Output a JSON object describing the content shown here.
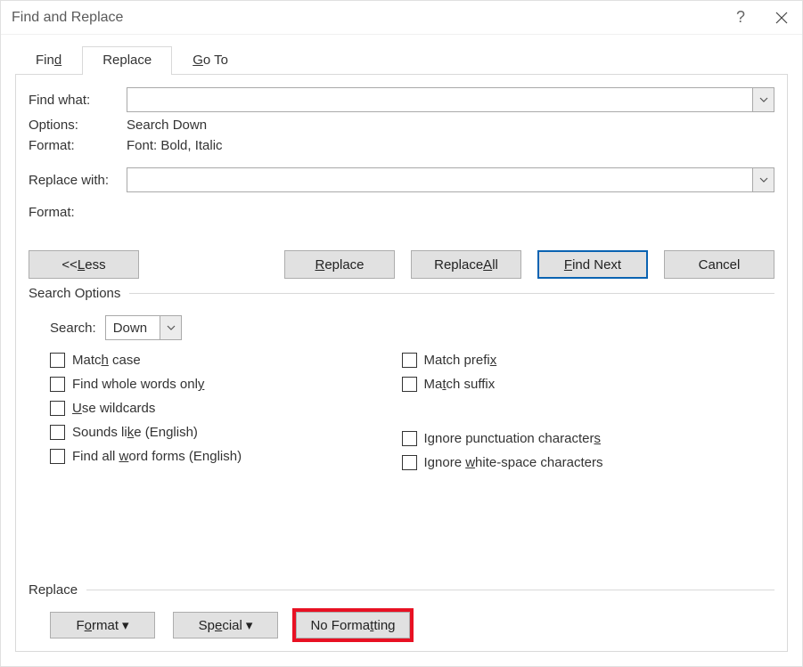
{
  "titlebar": {
    "title": "Find and Replace"
  },
  "tabs": {
    "find": "Find",
    "replace": "Replace",
    "goto": "Go To",
    "find_ul": "d",
    "goto_ul": "G"
  },
  "findwhat": {
    "label": "Find what:",
    "value": "",
    "ul": "n"
  },
  "options": {
    "label": "Options:",
    "value": "Search Down"
  },
  "format": {
    "label": "Format:",
    "value": "Font: Bold, Italic"
  },
  "replacewith": {
    "label": "Replace with:",
    "value": "",
    "ul": "i"
  },
  "format2": {
    "label": "Format:",
    "value": ""
  },
  "buttons": {
    "less": "<< Less",
    "less_ul": "L",
    "replace": "Replace",
    "replace_ul": "R",
    "replace_all": "Replace All",
    "replace_all_ul": "A",
    "find_next": "Find Next",
    "find_next_ul": "F",
    "cancel": "Cancel"
  },
  "search_options": {
    "legend": "Search Options",
    "search_label": "Search:",
    "search_ul": ":",
    "direction": "Down",
    "match_case": "Match case",
    "match_case_ul": "h",
    "whole_words": "Find whole words only",
    "whole_words_ul": "y",
    "wildcards": "Use wildcards",
    "wildcards_ul": "U",
    "sounds_like": "Sounds like (English)",
    "sounds_like_ul": "k",
    "word_forms": "Find all word forms (English)",
    "word_forms_ul": "w",
    "match_prefix": "Match prefix",
    "match_prefix_ul": "x",
    "match_suffix": "Match suffix",
    "match_suffix_ul": "t",
    "ignore_punct": "Ignore punctuation characters",
    "ignore_punct_ul": "s",
    "ignore_ws": "Ignore white-space characters",
    "ignore_ws_ul": "w"
  },
  "replace_section": {
    "legend": "Replace",
    "format_btn": "Format",
    "format_btn_ul": "o",
    "special_btn": "Special",
    "special_btn_ul": "e",
    "no_formatting": "No Formatting",
    "no_formatting_ul": "t"
  }
}
